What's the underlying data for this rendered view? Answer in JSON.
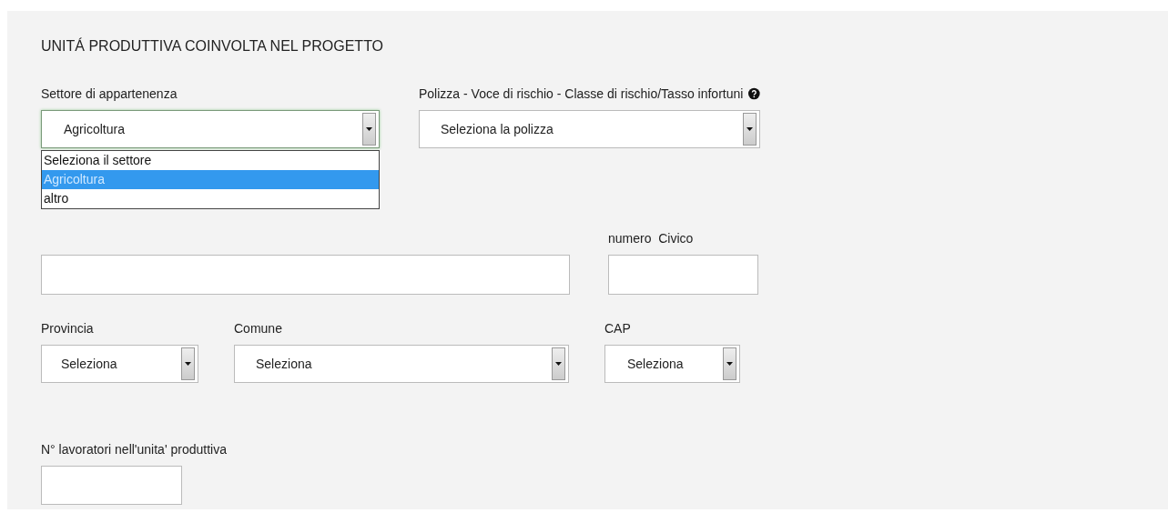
{
  "section": {
    "title": "UNITÁ PRODUTTIVA COINVOLTA NEL PROGETTO"
  },
  "rows": [
    [
      {
        "kind": "select",
        "label": "Settore di appartenenza",
        "value": "Agricoltura",
        "open": true,
        "options": [
          {
            "label": "Seleziona il settore",
            "selected": false
          },
          {
            "label": "Agricoltura",
            "selected": true
          },
          {
            "label": "altro",
            "selected": false
          }
        ]
      },
      {
        "kind": "select",
        "label": "Polizza - Voce di rischio - Classe di rischio/Tasso infortuni",
        "help": true,
        "value": "Seleziona la polizza",
        "open": false
      }
    ],
    [
      {
        "kind": "text"
      },
      {
        "kind": "text",
        "label": "numero  Civico"
      }
    ],
    [
      {
        "kind": "select",
        "label": "Provincia",
        "value": "Seleziona",
        "open": false
      },
      {
        "kind": "select",
        "label": "Comune",
        "value": "Seleziona",
        "open": false
      },
      {
        "kind": "select",
        "label": "CAP",
        "value": "Seleziona",
        "open": false
      }
    ],
    [
      {
        "kind": "text",
        "label": "N° lavoratori nell'unita' produttiva"
      }
    ]
  ]
}
